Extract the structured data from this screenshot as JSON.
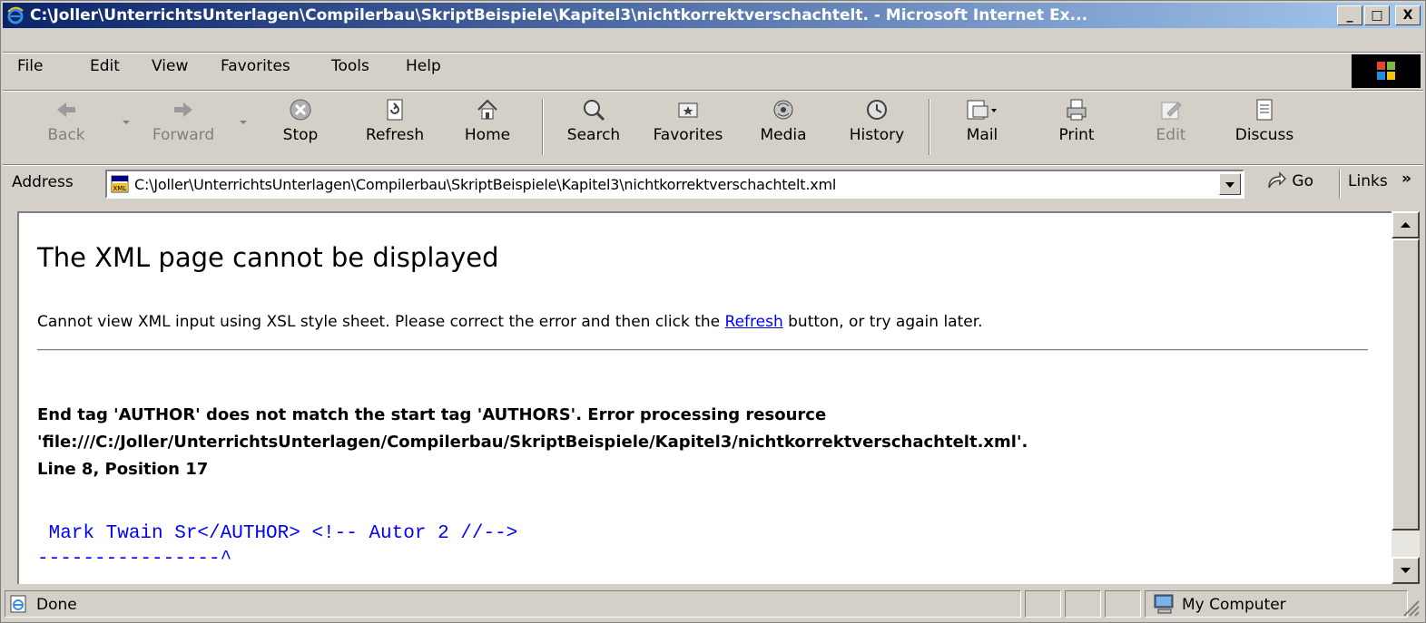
{
  "window": {
    "title": "C:\\Joller\\UnterrichtsUnterlagen\\Compilerbau\\SkriptBeispiele\\Kapitel3\\nichtkorrektverschachtelt. - Microsoft Internet Ex...",
    "buttons": [
      "_",
      "□",
      "X"
    ]
  },
  "menu": {
    "file": "File",
    "edit": "Edit",
    "view": "View",
    "favorites": "Favorites",
    "tools": "Tools",
    "help": "Help"
  },
  "toolbar": {
    "back": "Back",
    "forward": "Forward",
    "stop": "Stop",
    "refresh": "Refresh",
    "home": "Home",
    "search": "Search",
    "favorites": "Favorites",
    "media": "Media",
    "history": "History",
    "mail": "Mail",
    "print": "Print",
    "edit": "Edit",
    "discuss": "Discuss"
  },
  "address": {
    "label": "Address",
    "url": "C:\\Joller\\UnterrichtsUnterlagen\\Compilerbau\\SkriptBeispiele\\Kapitel3\\nichtkorrektverschachtelt.xml",
    "go": "Go",
    "links": "Links",
    "links_more": "»"
  },
  "page": {
    "heading": "The XML page cannot be displayed",
    "message_before": "Cannot view XML input using XSL style sheet. Please correct the error and then click the ",
    "message_link": "Refresh",
    "message_after": " button, or try again later.",
    "error_line1": "End tag 'AUTHOR' does not match the start tag 'AUTHORS'. Error processing resource",
    "error_line2": "'file:///C:/Joller/UnterrichtsUnterlagen/Compilerbau/SkriptBeispiele/Kapitel3/nichtkorrektverschachtelt.xml'.",
    "error_line3": "Line 8, Position 17",
    "code_line": " Mark Twain Sr</AUTHOR> <!-- Autor 2 //-->",
    "caret_line": "----------------^"
  },
  "status": {
    "text": "Done",
    "zone": "My Computer"
  },
  "colors": {
    "title_gradient_start": "#0a246a",
    "title_gradient_end": "#a6caf0",
    "link": "#0000ff",
    "chrome": "#d4d0c8"
  }
}
